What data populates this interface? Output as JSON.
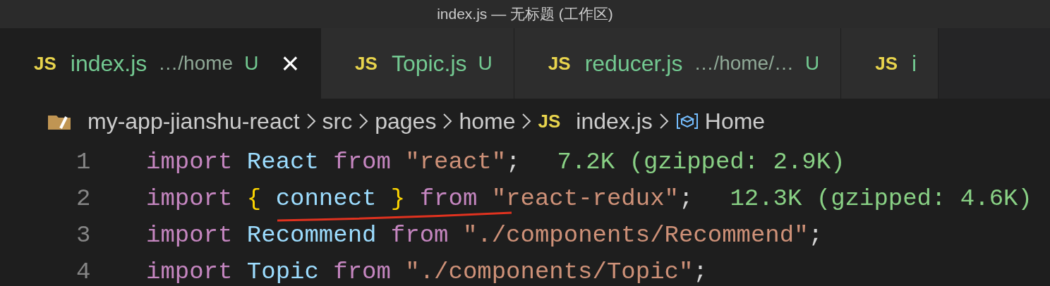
{
  "window": {
    "title": "index.js — 无标题 (工作区)"
  },
  "tabs": [
    {
      "icon": "JS",
      "label": "index.js",
      "description": "…/home",
      "status": "U",
      "selected": true,
      "close": "×"
    },
    {
      "icon": "JS",
      "label": "Topic.js",
      "status": "U",
      "selected": false
    },
    {
      "icon": "JS",
      "label": "reducer.js",
      "description": "…/home/…",
      "status": "U",
      "selected": false
    },
    {
      "icon": "JS",
      "label": "i",
      "selected": false
    }
  ],
  "breadcrumbs": [
    {
      "kind": "folder",
      "label": "my-app-jianshu-react"
    },
    {
      "kind": "plain",
      "label": "src"
    },
    {
      "kind": "plain",
      "label": "pages"
    },
    {
      "kind": "plain",
      "label": "home"
    },
    {
      "kind": "file",
      "icon": "JS",
      "label": "index.js"
    },
    {
      "kind": "symbol",
      "label": "Home"
    }
  ],
  "code": [
    {
      "number": "1",
      "tokens": [
        {
          "kind": "keyword",
          "text": "import"
        },
        {
          "kind": "variable",
          "text": " React"
        },
        {
          "kind": "keyword",
          "text": " from"
        },
        {
          "kind": "string",
          "text": " \"react\""
        },
        {
          "kind": "plain",
          "text": ";"
        }
      ],
      "import_cost": "7.2K (gzipped: 2.9K)"
    },
    {
      "number": "2",
      "tokens": [
        {
          "kind": "keyword",
          "text": "import"
        },
        {
          "kind": "brace",
          "text": " {"
        },
        {
          "kind": "variable",
          "text": " connect"
        },
        {
          "kind": "brace",
          "text": " }"
        },
        {
          "kind": "keyword",
          "text": " from"
        },
        {
          "kind": "string",
          "text": " \"react-redux\""
        },
        {
          "kind": "plain",
          "text": ";"
        }
      ],
      "import_cost": "12.3K (gzipped: 4.6K)"
    },
    {
      "number": "3",
      "tokens": [
        {
          "kind": "keyword",
          "text": "import"
        },
        {
          "kind": "variable",
          "text": " Recommend"
        },
        {
          "kind": "keyword",
          "text": " from"
        },
        {
          "kind": "string",
          "text": " \"./components/Recommend\""
        },
        {
          "kind": "plain",
          "text": ";"
        }
      ]
    },
    {
      "number": "4",
      "tokens": [
        {
          "kind": "keyword",
          "text": "import"
        },
        {
          "kind": "variable",
          "text": " Topic"
        },
        {
          "kind": "keyword",
          "text": " from"
        },
        {
          "kind": "string",
          "text": " \"./components/Topic\""
        },
        {
          "kind": "plain",
          "text": ";"
        }
      ]
    }
  ]
}
